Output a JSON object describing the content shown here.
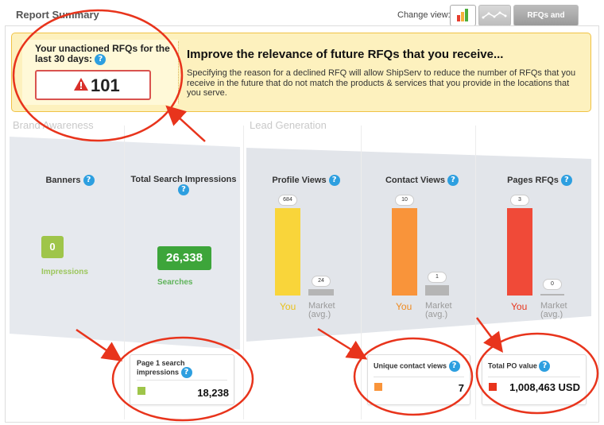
{
  "header": {
    "title": "Report Summary",
    "change_view_label": "Change view:",
    "rfq_orders_button": "RFQs and Orders"
  },
  "banner": {
    "rfq_label": "Your unactioned RFQs for the last 30 days:",
    "rfq_count": "101",
    "title": "Improve the relevance of future RFQs that you receive...",
    "text": "Specifying the reason for a declined RFQ will allow ShipServ to reduce the number of RFQs that you receive in the future that do not match the products & services that you provide in the locations that you serve."
  },
  "sections": {
    "brand_awareness": "Brand Awareness",
    "lead_generation": "Lead Generation"
  },
  "metrics": {
    "banners": {
      "title": "Banners",
      "value": "0",
      "label": "Impressions"
    },
    "search": {
      "title": "Total Search Impressions",
      "value": "26,338",
      "label": "Searches"
    },
    "profile_views": {
      "title": "Profile Views",
      "you": 684,
      "market": 24,
      "you_label": "You",
      "market_label_1": "Market",
      "market_label_2": "(avg.)"
    },
    "contact_views": {
      "title": "Contact Views",
      "you": 10,
      "market": 1,
      "you_label": "You",
      "market_label_1": "Market",
      "market_label_2": "(avg.)"
    },
    "pages_rfqs": {
      "title": "Pages RFQs",
      "you": 3,
      "market": 0,
      "you_label": "You",
      "market_label_1": "Market",
      "market_label_2": "(avg.)"
    }
  },
  "cards": {
    "page1": {
      "title": "Page 1 search impressions",
      "value": "18,238"
    },
    "contact": {
      "title": "Unique contact views",
      "value": "7"
    },
    "po": {
      "title": "Total PO value",
      "value": "1,008,463 USD"
    }
  },
  "colors": {
    "profile_bar": "#f9d53a",
    "contact_bar": "#f9943a",
    "rfq_bar": "#f04a38",
    "market_bar": "#b5b5b5",
    "annotation": "#e8341c"
  }
}
